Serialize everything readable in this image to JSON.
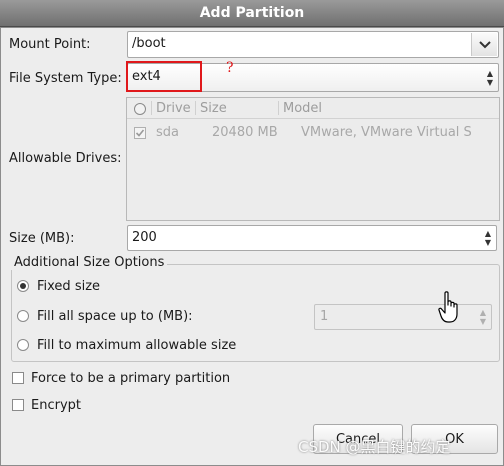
{
  "window": {
    "title": "Add Partition"
  },
  "form": {
    "mount_point": {
      "label": "Mount Point:",
      "value": "/boot"
    },
    "fs_type": {
      "label": "File System Type:",
      "value": "ext4"
    },
    "allowable_drives": {
      "label": "Allowable Drives:",
      "columns": [
        "Drive",
        "Size",
        "Model"
      ],
      "rows": [
        {
          "drive": "sda",
          "size": "20480 MB",
          "model": "VMware, VMware Virtual S"
        }
      ]
    },
    "size": {
      "label": "Size (MB):",
      "value": "200"
    }
  },
  "size_options": {
    "title": "Additional Size Options",
    "fixed": "Fixed size",
    "fill_up_to": "Fill all space up to (MB):",
    "fill_up_to_value": "1",
    "fill_max": "Fill to maximum allowable size"
  },
  "checks": {
    "primary": "Force to be a primary partition",
    "encrypt": "Encrypt"
  },
  "buttons": {
    "cancel": "Cancel",
    "ok": "OK"
  },
  "annotation": {
    "mark": "?"
  },
  "watermark": "CSDN @黑白键的约定"
}
